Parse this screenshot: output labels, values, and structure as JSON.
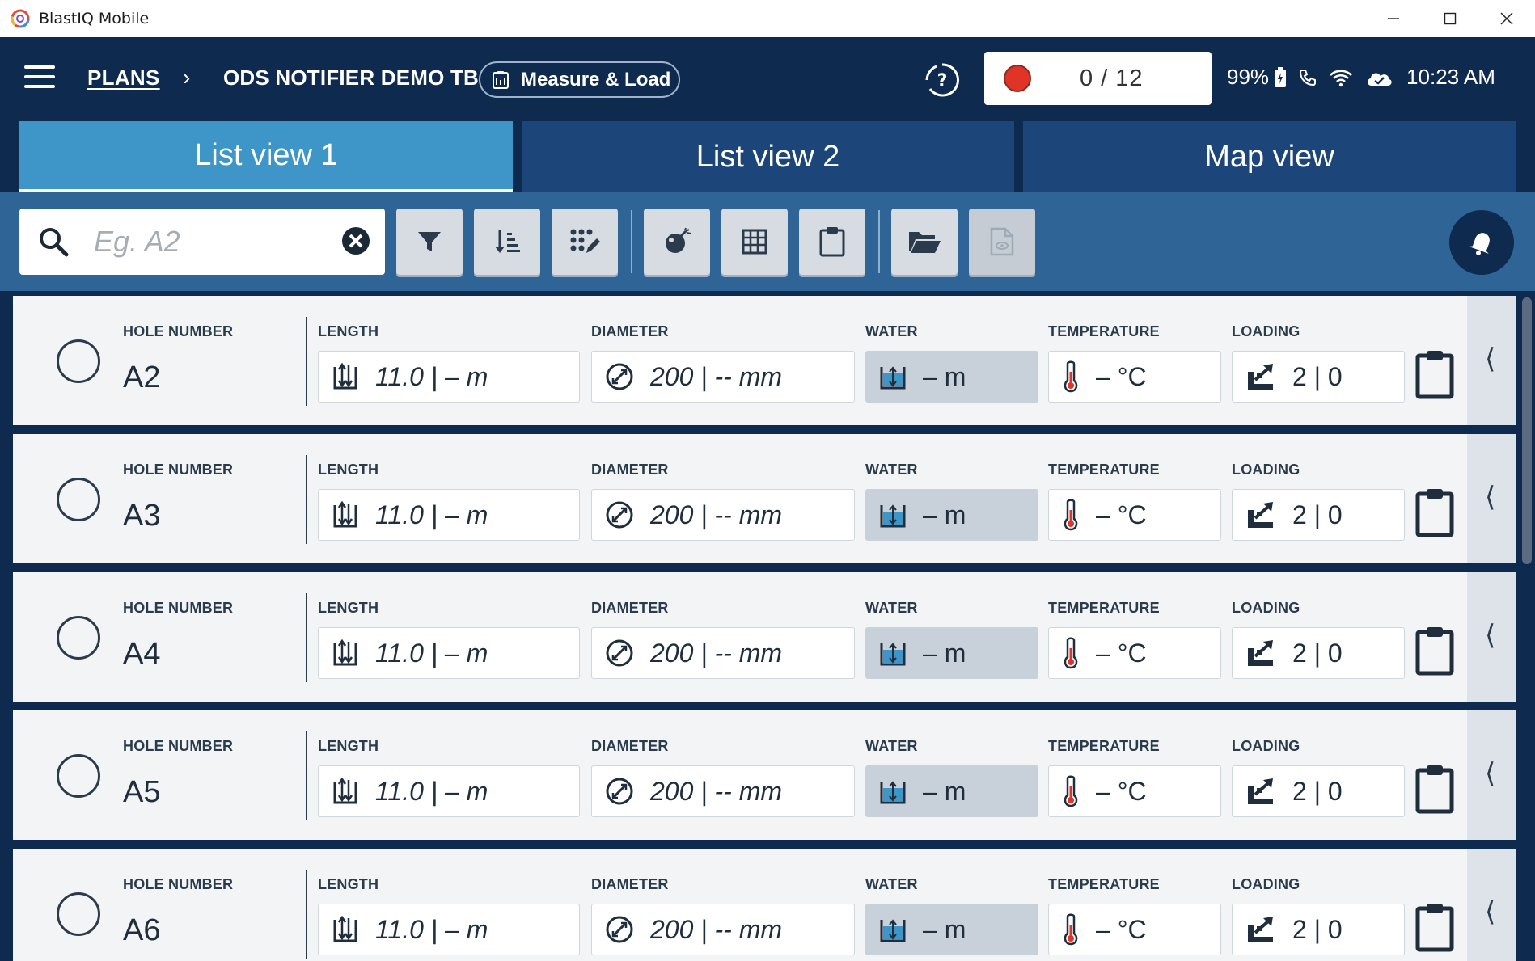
{
  "window": {
    "title": "BlastIQ Mobile"
  },
  "header": {
    "breadcrumb_plans": "PLANS",
    "breadcrumb_sep": "›",
    "plan_name": "ODS NOTIFIER DEMO TB",
    "mode_label": "Measure & Load",
    "progress": "0 / 12",
    "battery": "99%",
    "time": "10:23 AM"
  },
  "tabs": [
    {
      "label": "List view 1",
      "active": true
    },
    {
      "label": "List view 2",
      "active": false
    },
    {
      "label": "Map view",
      "active": false
    }
  ],
  "search": {
    "placeholder": "Eg. A2",
    "value": ""
  },
  "labels": {
    "hole_number": "HOLE NUMBER",
    "length": "LENGTH",
    "diameter": "DIAMETER",
    "water": "WATER",
    "temperature": "TEMPERATURE",
    "loading": "LOADING"
  },
  "rows": [
    {
      "hole": "A2",
      "length": "11.0  |  –  m",
      "diameter": "200 | --  mm",
      "water": "– m",
      "temperature": "– °C",
      "loading": "2 | 0"
    },
    {
      "hole": "A3",
      "length": "11.0  |  –  m",
      "diameter": "200 | --  mm",
      "water": "– m",
      "temperature": "– °C",
      "loading": "2 | 0"
    },
    {
      "hole": "A4",
      "length": "11.0  |  –  m",
      "diameter": "200 | --  mm",
      "water": "– m",
      "temperature": "– °C",
      "loading": "2 | 0"
    },
    {
      "hole": "A5",
      "length": "11.0  |  –  m",
      "diameter": "200 | --  mm",
      "water": "– m",
      "temperature": "– °C",
      "loading": "2 | 0"
    },
    {
      "hole": "A6",
      "length": "11.0  |  –  m",
      "diameter": "200 | --  mm",
      "water": "– m",
      "temperature": "– °C",
      "loading": "2 | 0"
    }
  ],
  "colors": {
    "header_bg": "#0f2a4f",
    "tab_active": "#3e95c8",
    "tab_inactive": "#1c4579",
    "toolbar_bg": "#2f6596",
    "record_dot": "#e03426"
  },
  "icons": {
    "toolbar": [
      "filter-icon",
      "sort-icon",
      "bulk-edit-icon",
      "explosive-icon",
      "grid-icon",
      "clipboard-icon",
      "folder-open-icon",
      "document-view-icon"
    ],
    "row": [
      "length-icon",
      "diameter-icon",
      "water-icon",
      "thermometer-icon",
      "loading-icon",
      "clipboard-icon"
    ]
  }
}
